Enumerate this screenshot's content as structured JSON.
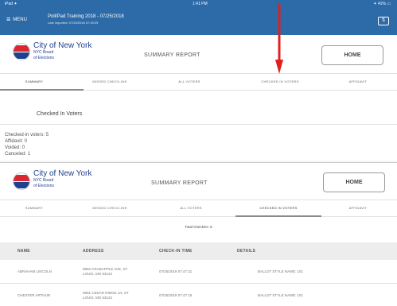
{
  "status_bar": {
    "carrier": "iPad ✦",
    "time": "1:41 PM",
    "battery": "✦ 41% ▭",
    "menu_icon": "hamburger-icon",
    "menu_label": "MENU",
    "event_name": "Poll/Pad Training 2018 - 07/25/2018",
    "event_sub": "Last Imported: 07/25/2018 07:49:09"
  },
  "header": {
    "org_line1": "City of New York",
    "org_line2": "NYC Board",
    "org_line3": "of Elections",
    "report_title": "SUMMARY REPORT",
    "home_button": "HOME"
  },
  "tabs": [
    "SUMMARY",
    "MISSED CHECK-INS",
    "ALL VOTERS",
    "CHECKED IN VOTERS",
    "AFFIDAVIT"
  ],
  "panel1": {
    "active_tab": 0,
    "section_title": "Checked In Voters",
    "stats": [
      "Checked-in voters: 5",
      "Affidavit: 0",
      "Voided: 0",
      "Canceled: 1"
    ]
  },
  "panel2": {
    "active_tab": 3,
    "total_label": "Total Checkins: 8",
    "columns": [
      "NAME",
      "ADDRESS",
      "CHECK-IN TIME",
      "DETAILS"
    ],
    "rows": [
      {
        "name": "ABRAHAM LINCOLN",
        "address_line1": "9802 CRABAPPLE AVE, ST",
        "address_line2": "LOUIS, MO 63124",
        "time": "07/25/2018 07:47:31",
        "details": "BALLOT STYLE NAME: 101"
      },
      {
        "name": "CHESTER ARTHUR",
        "address_line1": "9801 CEDAR RIDGE LN, ST",
        "address_line2": "LOUIS, MO 63124",
        "time": "07/25/2018 07:47:15",
        "details": "BALLOT STYLE NAME: 101"
      }
    ]
  },
  "colors": {
    "status_bar": "#2d6aa8",
    "brand_blue": "#1f3f8f",
    "brand_red": "#d9282f",
    "annotation_arrow": "#e02020"
  },
  "annotation": {
    "icon": "red-arrow-icon"
  }
}
